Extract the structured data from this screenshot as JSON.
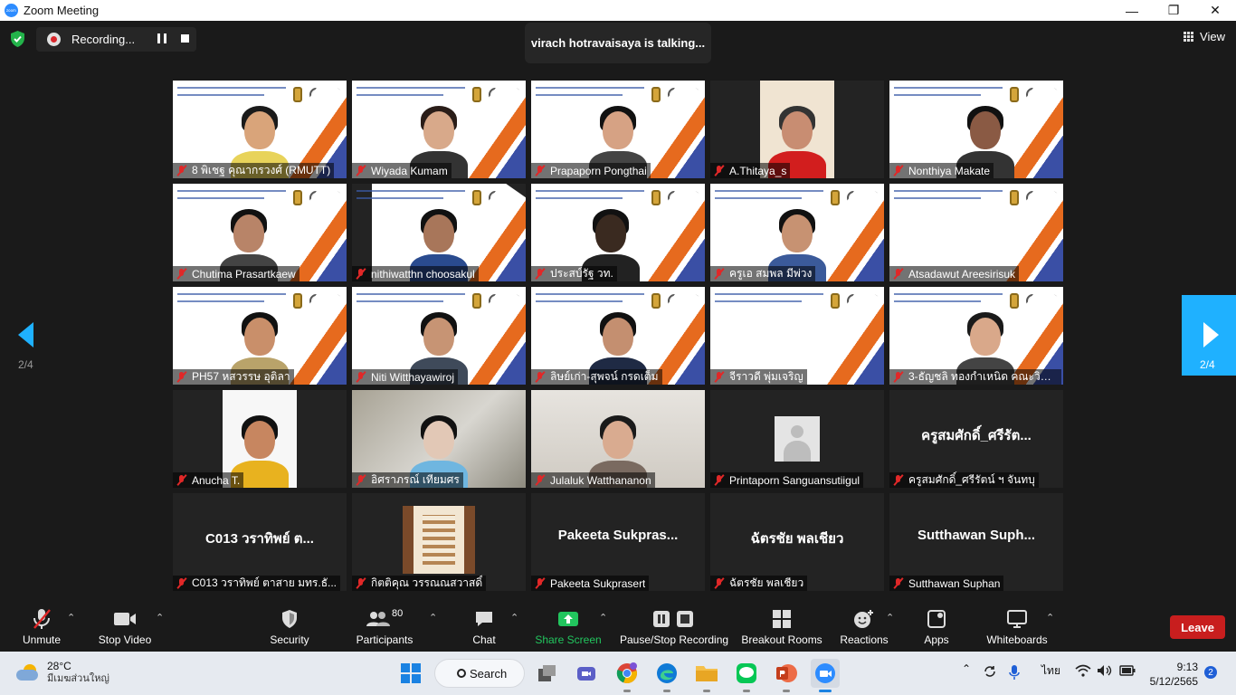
{
  "window": {
    "title": "Zoom Meeting",
    "logo_text": "zoom"
  },
  "topbar": {
    "recording_label": "Recording...",
    "talking_text": "virach hotravaisaya is talking...",
    "view_label": "View"
  },
  "pager": {
    "left_page": "2/4",
    "right_page": "2/4"
  },
  "tiles": [
    {
      "name": "8 พิเชฐ  คุณากรวงศ์ (RMUTT)",
      "kind": "slide"
    },
    {
      "name": "Wiyada Kumam",
      "kind": "slide"
    },
    {
      "name": "Prapaporn Pongthai",
      "kind": "slide"
    },
    {
      "name": "A.Thitaya_s",
      "kind": "video"
    },
    {
      "name": "Nonthiya Makate",
      "kind": "slide"
    },
    {
      "name": "Chutima Prasartkaew",
      "kind": "slide"
    },
    {
      "name": "nithiwatthn choosakul",
      "kind": "slide"
    },
    {
      "name": "ประสบ์รัฐ วท.",
      "kind": "slide"
    },
    {
      "name": "ครูเอ สมพล มีพ่วง",
      "kind": "slide"
    },
    {
      "name": "Atsadawut Areesirisuk",
      "kind": "slide"
    },
    {
      "name": "PH57 หสวรรษ อุติลา",
      "kind": "slide"
    },
    {
      "name": "Niti Witthayawiroj",
      "kind": "slide"
    },
    {
      "name": "ลิษย์เก่า-สุพจน์ กรดเต็ม",
      "kind": "slide"
    },
    {
      "name": "จีราวดี พุ่มเจริญ",
      "kind": "slide"
    },
    {
      "name": "3-ธัญชลิ ทองกำเหนิด คณะวิทย...",
      "kind": "slide"
    },
    {
      "name": "Anucha T.",
      "kind": "video"
    },
    {
      "name": "อิศราภรณ์  เทียมศร",
      "kind": "video"
    },
    {
      "name": "Julaluk Watthananon",
      "kind": "video"
    },
    {
      "name": "Printaporn Sanguansutiigul",
      "kind": "avatar"
    },
    {
      "name": "ครูสมศักดิ์_ศรีรัตน์ ฯ จันทบุ",
      "kind": "text",
      "big": "ครูสมศักดิ์_ศรีรัต..."
    },
    {
      "name": "C013 วราทิพย์  ตาสาย มทร.ธั...",
      "kind": "text",
      "big": "C013  วราทิพย์  ต..."
    },
    {
      "name": "กิตติคุณ วรรณณสวาสดิ์",
      "kind": "photo"
    },
    {
      "name": "Pakeeta Sukprasert",
      "kind": "text",
      "big": "Pakeeta  Sukpras..."
    },
    {
      "name": "ฉัตรชัย พลเชียว",
      "kind": "text",
      "big": "ฉัตรชัย  พลเชียว"
    },
    {
      "name": "Sutthawan Suphan",
      "kind": "text",
      "big": "Sutthawan  Suph..."
    }
  ],
  "toolbar": {
    "unmute": "Unmute",
    "stop_video": "Stop Video",
    "security": "Security",
    "participants": "Participants",
    "participant_count": "80",
    "chat": "Chat",
    "share_screen": "Share Screen",
    "pause_stop_recording": "Pause/Stop Recording",
    "breakout_rooms": "Breakout Rooms",
    "reactions": "Reactions",
    "apps": "Apps",
    "whiteboards": "Whiteboards",
    "leave": "Leave"
  },
  "taskbar": {
    "temperature": "28°C",
    "weather_desc": "มีเมฆส่วนใหญ่",
    "search_label": "Search",
    "language": "ไทย",
    "time": "9:13",
    "date": "5/12/2565",
    "notification_count": "2"
  },
  "colors": {
    "accent_blue": "#1fb1ff",
    "leave_red": "#c81e1e",
    "share_green": "#22c55e",
    "muted_red": "#e02828"
  }
}
